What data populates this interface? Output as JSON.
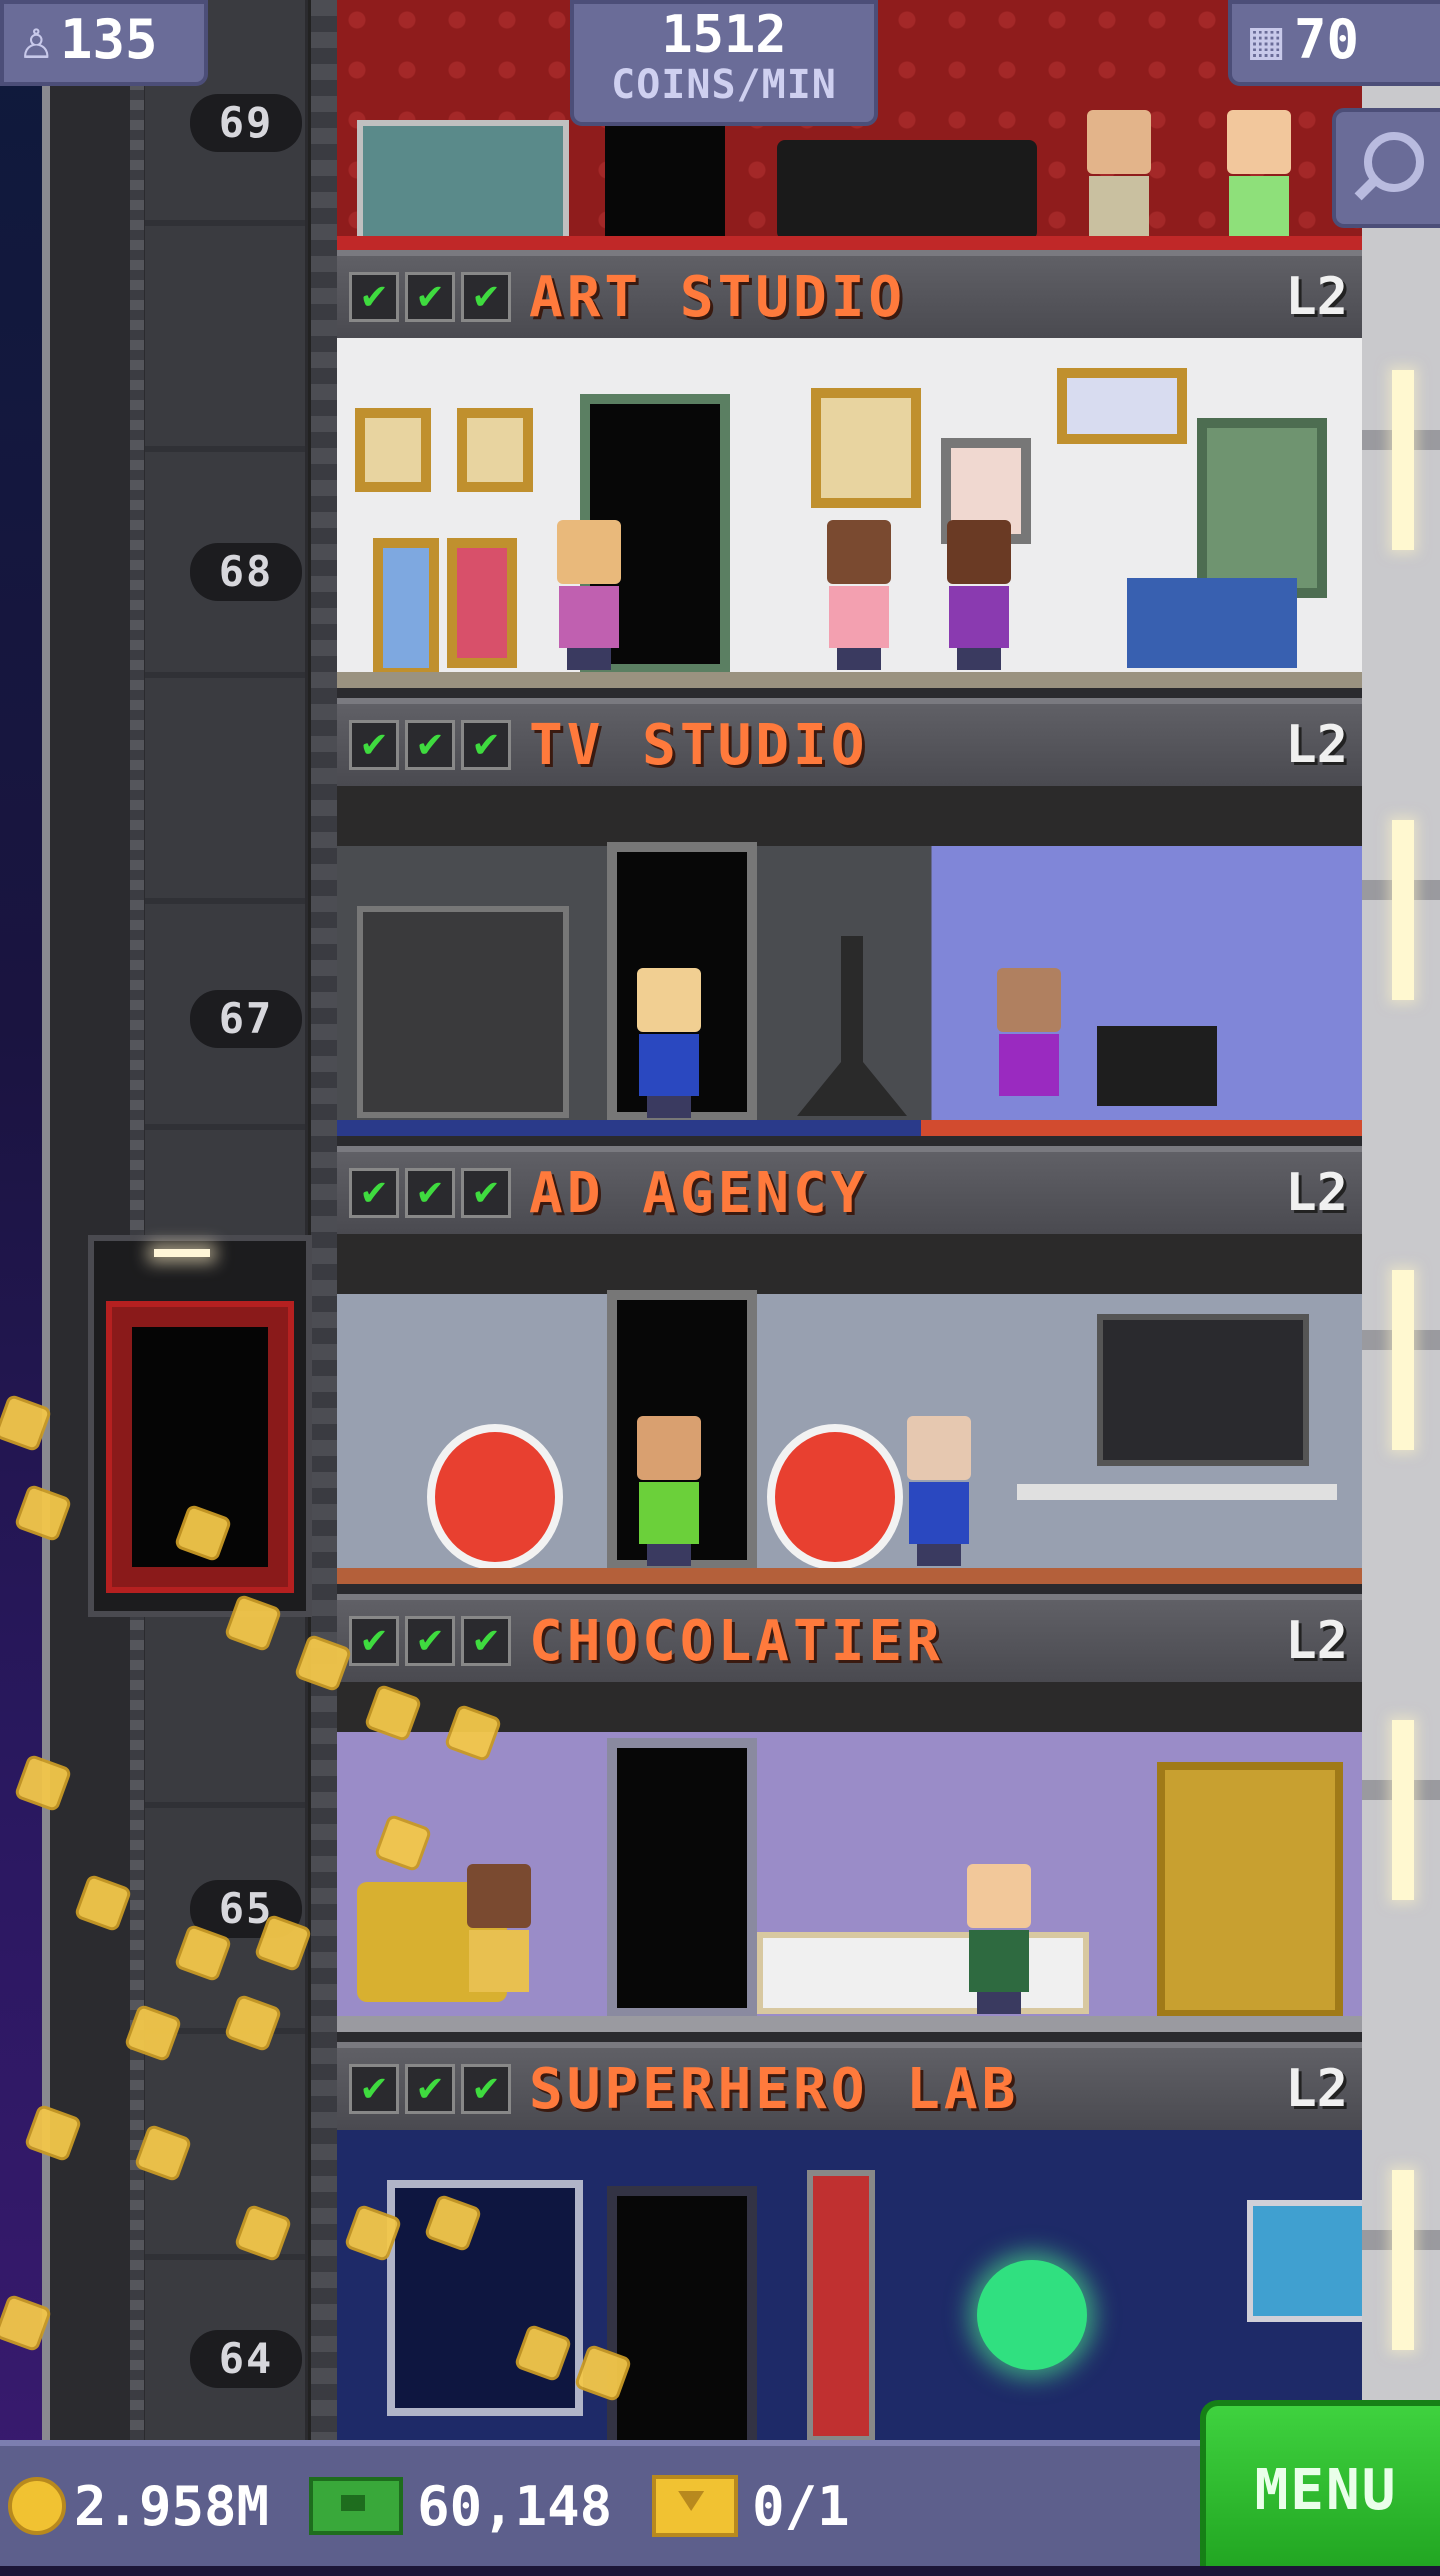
{
  "hud": {
    "population": "135",
    "coins_per_min_value": "1512",
    "coins_per_min_label": "COINS/MIN",
    "floors": "70",
    "search_icon": "magnifier-icon"
  },
  "elevator": {
    "floor_numbers": [
      "69",
      "68",
      "67",
      "65",
      "64"
    ]
  },
  "floors": [
    {
      "name": "ART STUDIO",
      "level": "L2",
      "checks": [
        "✔",
        "✔",
        "✔"
      ]
    },
    {
      "name": "TV STUDIO",
      "level": "L2",
      "checks": [
        "✔",
        "✔",
        "✔"
      ]
    },
    {
      "name": "AD AGENCY",
      "level": "L2",
      "checks": [
        "✔",
        "✔",
        "✔"
      ]
    },
    {
      "name": "CHOCOLATIER",
      "level": "L2",
      "checks": [
        "✔",
        "✔",
        "✔"
      ]
    },
    {
      "name": "SUPERHERO LAB",
      "level": "L2",
      "checks": [
        "✔",
        "✔",
        "✔"
      ]
    }
  ],
  "bottom_bar": {
    "coins": "2.958M",
    "bux": "60,148",
    "tickets": "0/1",
    "menu_label": "MENU"
  },
  "colors": {
    "hud_panel": "#6a6c98",
    "floor_name": "#ff7a3c",
    "check": "#3fdb3f",
    "menu_button": "#2fbf2f",
    "coin": "#f1c232"
  }
}
